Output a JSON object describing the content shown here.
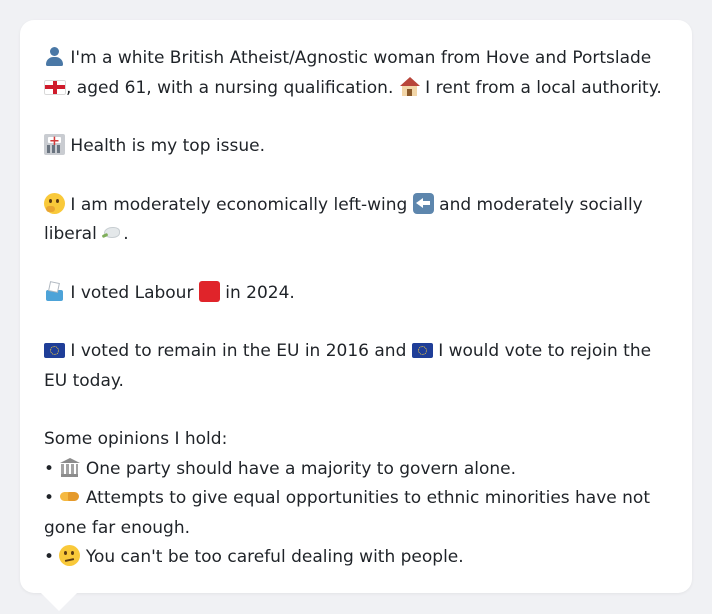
{
  "profile": {
    "intro_part1": "I'm a white British Atheist/Agnostic woman from Hove and Portslade",
    "intro_part2": ", aged 61, with a nursing qualification.",
    "intro_part3": "I rent from a local authority.",
    "top_issue": "Health is my top issue.",
    "ideology_part1": "I am moderately economically left-wing",
    "ideology_part2": "and moderately socially liberal",
    "ideology_part3": ".",
    "vote_part1": "I voted Labour",
    "vote_part2": "in 2024.",
    "eu_part1": "I voted to remain in the EU in 2016 and",
    "eu_part2": "I would vote to rejoin the EU today.",
    "opinions_heading": "Some opinions I hold:",
    "bullet_char": "•",
    "opinions": [
      "One party should have a majority to govern alone.",
      "Attempts to give equal opportunities to ethnic minorities have not gone far enough.",
      "You can't be too careful dealing with people."
    ]
  },
  "icons": {
    "intro": "person-icon",
    "region": "england-flag-icon",
    "housing": "house-icon",
    "issue": "hospital-icon",
    "ideology": "thinking-face-icon",
    "economic": "left-arrow-icon",
    "social": "dove-icon",
    "vote": "ballot-box-icon",
    "party": "red-square-icon",
    "eu": "eu-flag-icon",
    "opinions": [
      "classical-building-icon",
      "handshake-icon",
      "hmm-face-icon"
    ]
  },
  "colors": {
    "card_background": "#ffffff",
    "page_background": "#f0f1f4",
    "text": "#1f2328",
    "labour_red": "#e0242a",
    "eu_blue": "#1f3e98"
  }
}
